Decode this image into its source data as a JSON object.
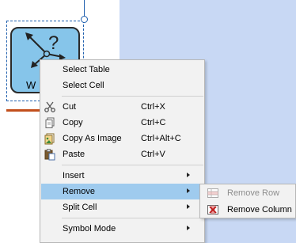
{
  "diagram": {
    "symbol_label": "W"
  },
  "context_menu": {
    "items": [
      {
        "label": "Select Table"
      },
      {
        "label": "Select Cell"
      },
      {
        "label": "Cut",
        "shortcut": "Ctrl+X",
        "icon": "scissors-icon"
      },
      {
        "label": "Copy",
        "shortcut": "Ctrl+C",
        "icon": "copy-icon"
      },
      {
        "label": "Copy As Image",
        "shortcut": "Ctrl+Alt+C",
        "icon": "copy-image-icon"
      },
      {
        "label": "Paste",
        "shortcut": "Ctrl+V",
        "icon": "paste-icon"
      },
      {
        "label": "Insert",
        "has_submenu": true
      },
      {
        "label": "Remove",
        "has_submenu": true,
        "highlighted": true
      },
      {
        "label": "Split Cell",
        "has_submenu": true
      },
      {
        "label": "Symbol Mode",
        "has_submenu": true
      }
    ]
  },
  "remove_submenu": {
    "items": [
      {
        "label": "Remove Row",
        "enabled": false,
        "icon": "remove-row-icon"
      },
      {
        "label": "Remove Column",
        "enabled": true,
        "icon": "remove-column-icon"
      }
    ]
  },
  "colors": {
    "highlight": "#9fcbee",
    "canvas_right": "#c8d8f4",
    "symbol_fill": "#86c5ea",
    "selection": "#1f5fae"
  }
}
